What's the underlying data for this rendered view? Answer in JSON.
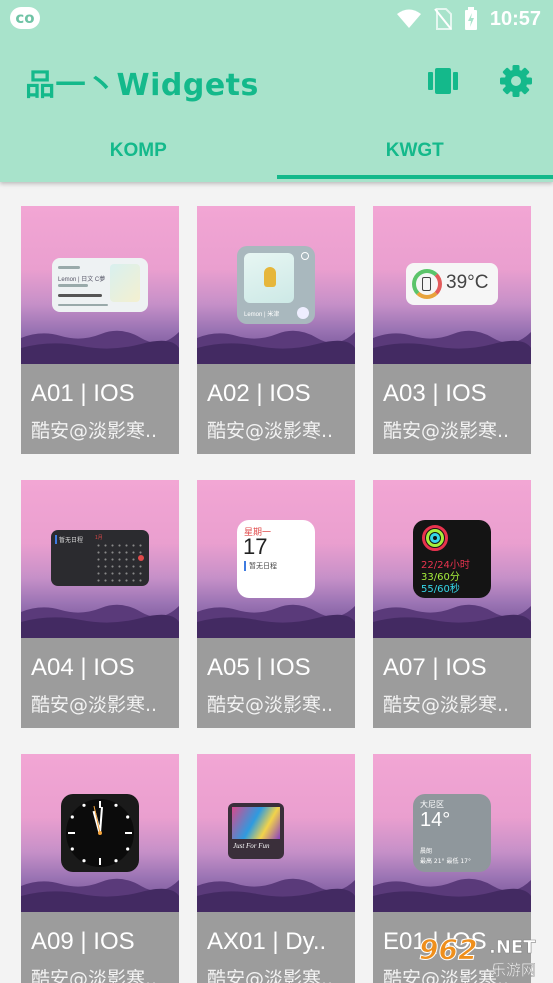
{
  "status_bar": {
    "time": "10:57",
    "app_icon": "co",
    "icons": [
      "wifi-icon",
      "no-sim-icon",
      "battery-charging-icon"
    ]
  },
  "app_bar": {
    "title": "品一丶Widgets",
    "actions": [
      "theme-icon",
      "settings-icon"
    ]
  },
  "tabs": [
    {
      "label": "KOMP",
      "active": false
    },
    {
      "label": "KWGT",
      "active": true
    }
  ],
  "colors": {
    "accent": "#14b98b",
    "appbar_bg": "#a8e3cb",
    "card_footer": "#9c9c9c"
  },
  "widgets": [
    {
      "title": "A01 | IOS",
      "author": "酷安@淡影寒..",
      "preview": {
        "type": "music",
        "label": "Lemon | 日文 C夢"
      }
    },
    {
      "title": "A02 | IOS",
      "author": "酷安@淡影寒..",
      "preview": {
        "type": "player",
        "label": "Lemon | 米津"
      }
    },
    {
      "title": "A03 | IOS",
      "author": "酷安@淡影寒..",
      "preview": {
        "type": "temperature",
        "temp": "39°C"
      }
    },
    {
      "title": "A04 | IOS",
      "author": "酷安@淡影寒..",
      "preview": {
        "type": "calendar",
        "event": "暂无日程",
        "month": "1月"
      }
    },
    {
      "title": "A05 | IOS",
      "author": "酷安@淡影寒..",
      "preview": {
        "type": "date",
        "weekday": "星期一",
        "day": "17",
        "event": "暂无日程"
      }
    },
    {
      "title": "A07 | IOS",
      "author": "酷安@淡影寒..",
      "preview": {
        "type": "activity",
        "lines": [
          "22/24小时",
          "33/60分",
          "55/60秒"
        ]
      }
    },
    {
      "title": "A09 | IOS",
      "author": "酷安@淡影寒..",
      "preview": {
        "type": "clock"
      }
    },
    {
      "title": "AX01 | Dy..",
      "author": "酷安@淡影寒..",
      "preview": {
        "type": "news",
        "caption": "Just For Fun"
      }
    },
    {
      "title": "E01 | IOS",
      "author": "酷安@淡影寒..",
      "preview": {
        "type": "weather",
        "city": "大尼区",
        "temp": "14°",
        "condition": "晨朗",
        "range": "最高 21° 最低 17°"
      }
    }
  ],
  "watermark": {
    "number": "962",
    "net": ".NET",
    "sub": "乐游网"
  }
}
